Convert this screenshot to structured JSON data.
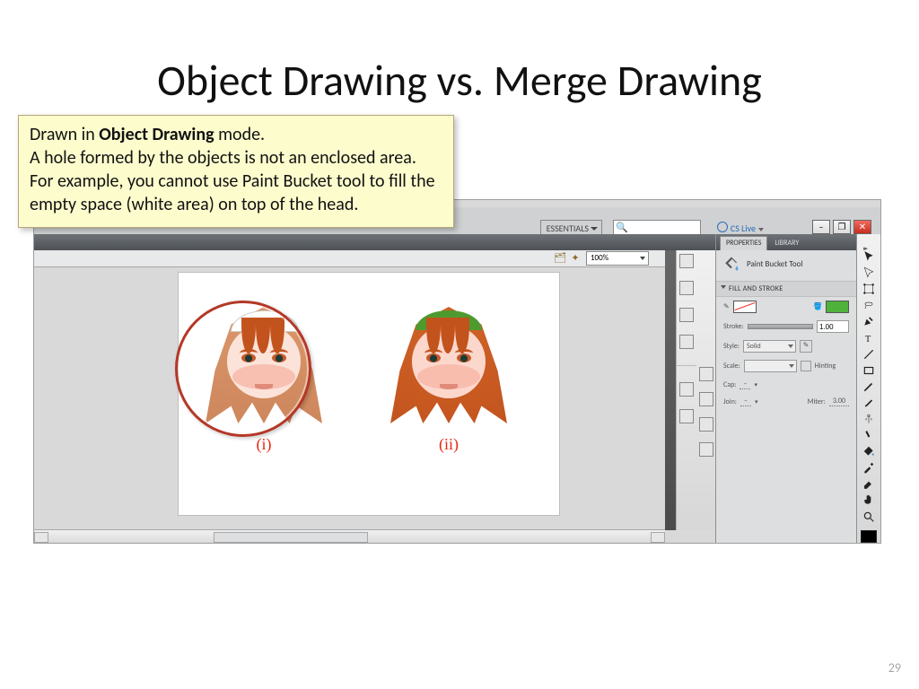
{
  "slide": {
    "title": "Object Drawing vs. Merge Drawing",
    "page_number": "29"
  },
  "callout": {
    "line1a": "Drawn in ",
    "line1b": "Object Drawing",
    "line1c": " mode.",
    "line2": "A hole formed by the objects is not an enclosed area.",
    "line3": "For example, you cannot use Paint Bucket tool to fill the empty space (white area) on top of the head."
  },
  "app": {
    "workspace_label": "ESSENTIALS",
    "cs_live": "CS Live",
    "zoom": "100%",
    "stage": {
      "label_i": "(i)",
      "label_ii": "(ii)"
    },
    "panel": {
      "tab_properties": "PROPERTIES",
      "tab_library": "LIBRARY",
      "tool_name": "Paint Bucket Tool",
      "section_fill_stroke": "FILL AND STROKE",
      "stroke_colors": {
        "stroke": "none",
        "fill": "#4fb23a"
      },
      "labels": {
        "stroke": "Stroke:",
        "style": "Style:",
        "style_value": "Solid",
        "scale": "Scale:",
        "hinting": "Hinting",
        "cap": "Cap:",
        "join": "Join:",
        "miter": "Miter:",
        "miter_value": "3.00",
        "stroke_weight": "1.00"
      }
    }
  }
}
